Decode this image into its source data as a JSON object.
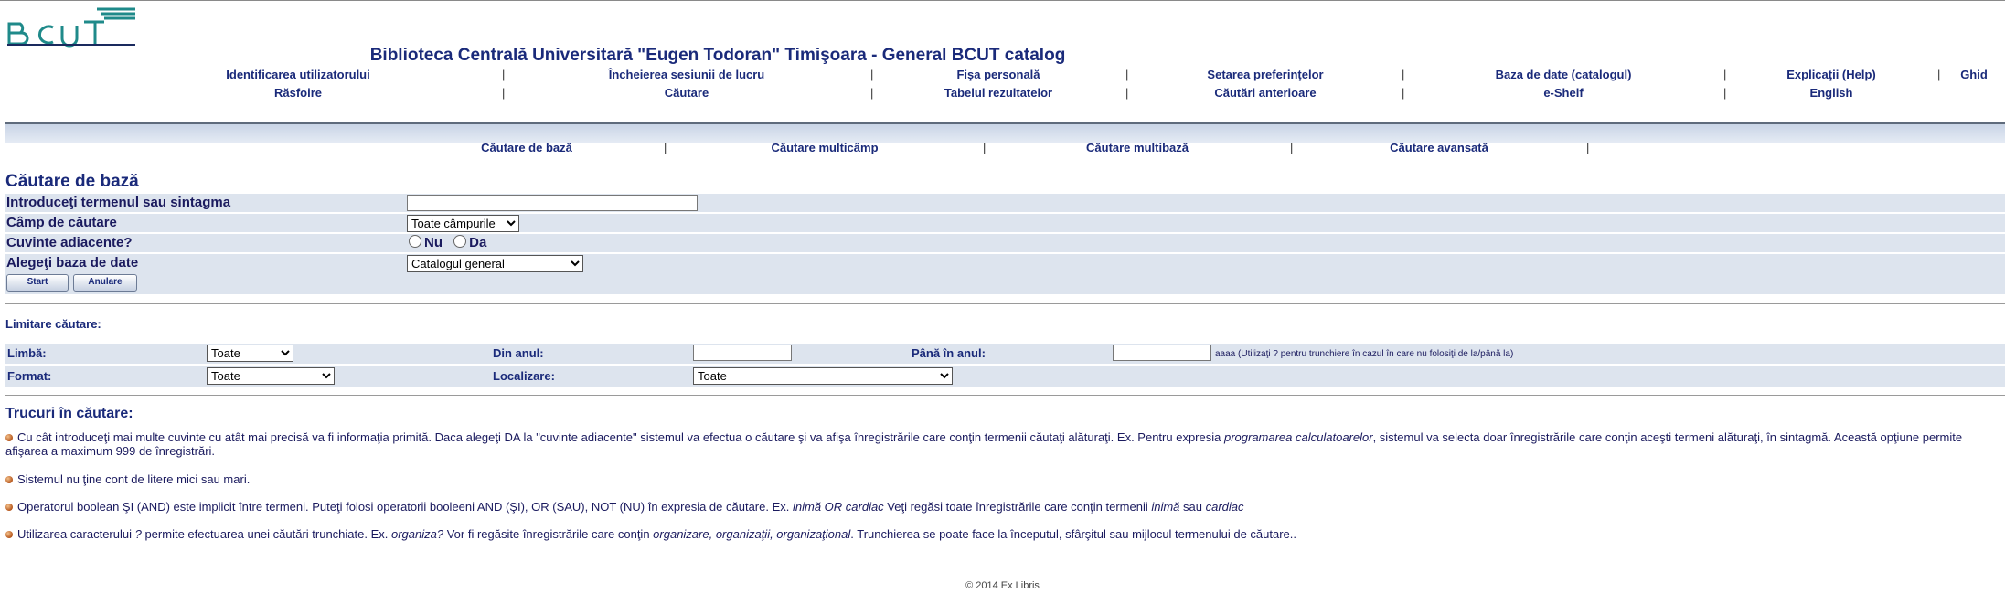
{
  "header": {
    "logo_text": "BCUT",
    "title": "Biblioteca Centrală Universitară \"Eugen Todoran\" Timişoara - General BCUT catalog"
  },
  "nav": {
    "row1": [
      "Identificarea utilizatorului",
      "Încheierea sesiunii de lucru",
      "Fişa personală",
      "Setarea preferinţelor",
      "Baza de date (catalogul)",
      "Explicaţii (Help)",
      "Ghid"
    ],
    "row2": [
      "Răsfoire",
      "Căutare",
      "Tabelul rezultatelor",
      "Căutări anterioare",
      "e-Shelf",
      "English"
    ],
    "separator": "|"
  },
  "subnav": [
    "Căutare de bază",
    "Căutare multicâmp",
    "Căutare multibază",
    "Căutare avansată"
  ],
  "search": {
    "title": "Căutare de bază",
    "term_label": "Introduceţi termenul sau sintagma",
    "term_value": "",
    "field_label": "Câmp de căutare",
    "field_selected": "Toate câmpurile",
    "adjacent_label": "Cuvinte adiacente?",
    "adjacent_no": "Nu",
    "adjacent_yes": "Da",
    "db_label": "Alegeţi baza de date",
    "db_selected": "Catalogul general",
    "start_button": "Start",
    "cancel_button": "Anulare"
  },
  "limits": {
    "title": "Limitare căutare:",
    "language_label": "Limbă:",
    "language_selected": "Toate",
    "from_year_label": "Din anul:",
    "to_year_label": "Până în anul:",
    "year_hint": "aaaa (Utilizaţi ? pentru trunchiere în cazul în care nu folosiţi de la/până la)",
    "format_label": "Format:",
    "format_selected": "Toate",
    "location_label": "Localizare:",
    "location_selected": "Toate"
  },
  "tips": {
    "title": "Trucuri în căutare:",
    "t1_a": "Cu cât introduceţi mai multe cuvinte cu atât mai precisă va fi informaţia primită. Daca alegeţi DA la \"cuvinte adiacente\" sistemul va efectua o căutare şi va afişa înregistrările care conţin termenii căutaţi alăturaţi. Ex. Pentru expresia ",
    "t1_em": "programarea calculatoarelor",
    "t1_b": ", sistemul va selecta doar înregistrările care conţin aceşti termeni alăturaţi, în sintagmă. Această opţiune permite afişarea a maximum 999 de înregistrări.",
    "t2": "Sistemul nu ţine cont de litere mici sau mari.",
    "t3_a": "Operatorul boolean ŞI (AND) este implicit între termeni. Puteţi folosi operatorii booleeni AND (ŞI), OR (SAU), NOT (NU) în expresia de căutare. Ex. ",
    "t3_em1": "inimă OR cardiac",
    "t3_b": " Veţi regăsi toate înregistrările care conţin termenii ",
    "t3_em2": "inimă",
    "t3_c": " sau ",
    "t3_em3": "cardiac",
    "t4_a": "Utilizarea caracterului ",
    "t4_em1": "?",
    "t4_b": " permite efectuarea unei căutări trunchiate. Ex. ",
    "t4_em2": "organiza?",
    "t4_c": " Vor fi regăsite înregistrările care conţin ",
    "t4_em3": "organizare, organizaţii, organizaţional",
    "t4_d": ". Trunchierea se poate face la începutul, sfârşitul sau mijlocul termenului de căutare.."
  },
  "footer": "© 2014 Ex Libris",
  "colors": {
    "title_blue": "#1a2a7a",
    "row_bg": "#dde4ee",
    "banner_top": "#5f6b7c"
  }
}
